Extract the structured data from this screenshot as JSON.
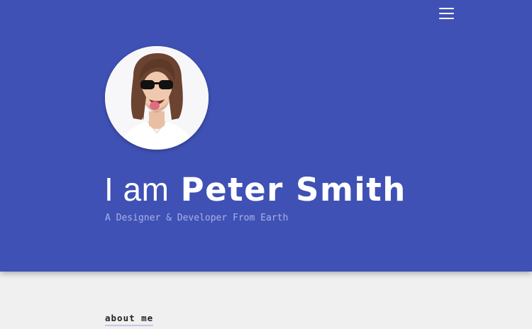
{
  "hero": {
    "greeting": "I am",
    "name": "Peter Smith",
    "tagline": "A Designer & Developer From Earth",
    "background_color": "#3f51b5",
    "avatar_icon": "avatar"
  },
  "nav": {
    "menu_icon": "hamburger-menu-icon"
  },
  "about": {
    "title": "about me"
  }
}
